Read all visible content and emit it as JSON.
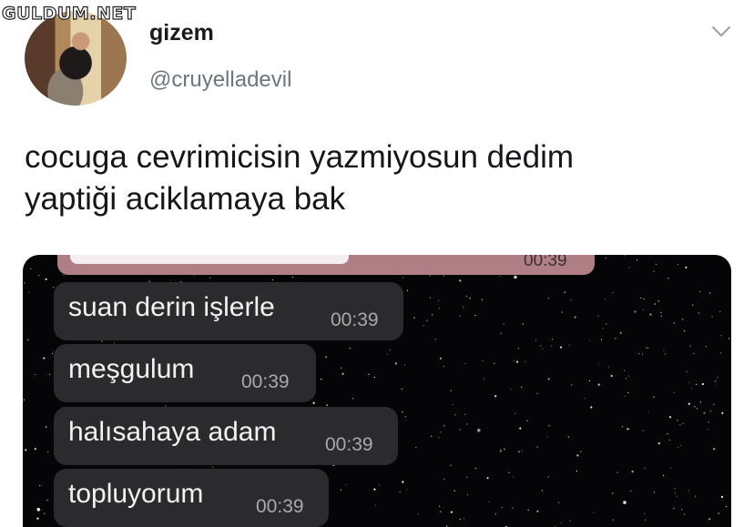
{
  "watermark": "GULDUM.NET",
  "user": {
    "name": "gizem",
    "handle": "@cruyelladevil"
  },
  "tweet": {
    "lines": [
      "cocuga cevrimicisin yazmiyosun dedim",
      "yaptiği aciklamaya bak"
    ]
  },
  "chat": {
    "previous_time": "00:39",
    "messages": [
      {
        "text": "suan derin işlerle",
        "time": "00:39"
      },
      {
        "text": "meşgulum",
        "time": "00:39"
      },
      {
        "text": "halısahaya adam",
        "time": "00:39"
      },
      {
        "text": "topluyorum",
        "time": "00:39"
      }
    ]
  },
  "icons": {
    "menu": "chevron-down-icon",
    "avatar": "profile-photo"
  },
  "colors": {
    "bubble": "#2b2b2d",
    "chat_background": "#050507",
    "handle": "#6b7680"
  }
}
